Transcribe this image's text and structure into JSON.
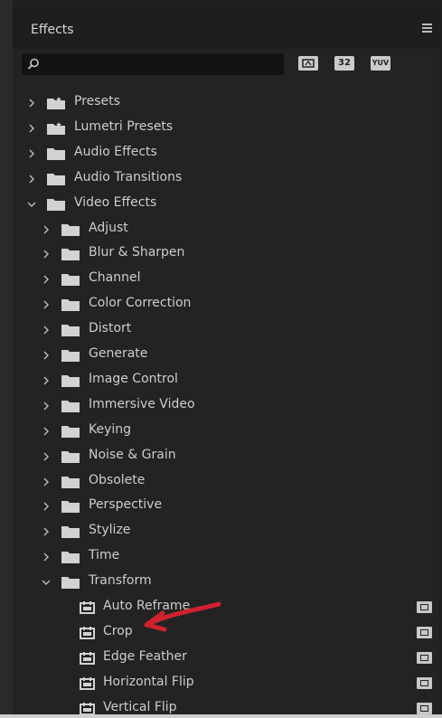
{
  "panel": {
    "title": "Effects",
    "menu_icon": "hamburger-menu-icon"
  },
  "search": {
    "value": "",
    "placeholder": "",
    "icon": "search-icon"
  },
  "filters": {
    "accelerated_label": "",
    "bit32_label": "32",
    "yuv_label": "YUV"
  },
  "tree": {
    "top_level": [
      {
        "label": "Presets",
        "icon": "preset-bin-icon",
        "expanded": false
      },
      {
        "label": "Lumetri Presets",
        "icon": "preset-bin-icon",
        "expanded": false
      },
      {
        "label": "Audio Effects",
        "icon": "folder-icon",
        "expanded": false
      },
      {
        "label": "Audio Transitions",
        "icon": "folder-icon",
        "expanded": false
      },
      {
        "label": "Video Effects",
        "icon": "folder-icon",
        "expanded": true
      }
    ],
    "video_effects": [
      "Adjust",
      "Blur & Sharpen",
      "Channel",
      "Color Correction",
      "Distort",
      "Generate",
      "Image Control",
      "Immersive Video",
      "Keying",
      "Noise & Grain",
      "Obsolete",
      "Perspective",
      "Stylize",
      "Time"
    ],
    "transform_folder": {
      "label": "Transform",
      "expanded": true
    },
    "transform_effects": [
      {
        "label": "Auto Reframe",
        "accelerated": true
      },
      {
        "label": "Crop",
        "accelerated": true
      },
      {
        "label": "Edge Feather",
        "accelerated": true
      },
      {
        "label": "Horizontal Flip",
        "accelerated": true
      },
      {
        "label": "Vertical Flip",
        "accelerated": true
      }
    ]
  },
  "annotation": {
    "arrow_color": "#d0222e",
    "points_to": "Crop"
  }
}
